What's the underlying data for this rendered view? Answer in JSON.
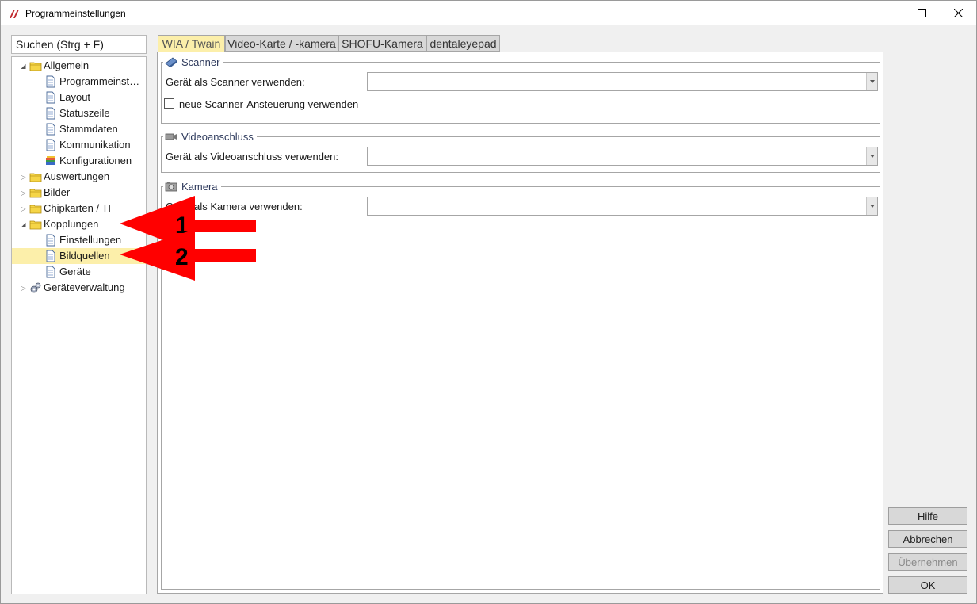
{
  "window": {
    "title": "Programmeinstellungen",
    "controls": {
      "minimize": "minimize-icon",
      "maximize": "maximize-icon",
      "close": "close-icon"
    }
  },
  "search": {
    "value": "Suchen (Strg + F)"
  },
  "tree": {
    "items": [
      {
        "label": "Allgemein",
        "icon": "folder-icon",
        "level": 0,
        "expanded": true
      },
      {
        "label": "Programmeinst…",
        "icon": "page-icon",
        "level": 1
      },
      {
        "label": "Layout",
        "icon": "page-icon",
        "level": 1
      },
      {
        "label": "Statuszeile",
        "icon": "page-icon",
        "level": 1
      },
      {
        "label": "Stammdaten",
        "icon": "page-icon",
        "level": 1
      },
      {
        "label": "Kommunikation",
        "icon": "page-icon",
        "level": 1
      },
      {
        "label": "Konfigurationen",
        "icon": "books-icon",
        "level": 1
      },
      {
        "label": "Auswertungen",
        "icon": "folder-icon",
        "level": 0,
        "expanded": false
      },
      {
        "label": "Bilder",
        "icon": "folder-icon",
        "level": 0,
        "expanded": false
      },
      {
        "label": "Chipkarten / TI",
        "icon": "folder-icon",
        "level": 0,
        "expanded": false
      },
      {
        "label": "Kopplungen",
        "icon": "folder-icon",
        "level": 0,
        "expanded": true
      },
      {
        "label": "Einstellungen",
        "icon": "page-icon",
        "level": 1
      },
      {
        "label": "Bildquellen",
        "icon": "page-icon",
        "level": 1,
        "selected": true
      },
      {
        "label": "Geräte",
        "icon": "page-icon",
        "level": 1
      },
      {
        "label": "Geräteverwaltung",
        "icon": "gears-icon",
        "level": 0,
        "expanded": false
      }
    ]
  },
  "tabs": [
    {
      "label": "WIA / Twain",
      "active": true
    },
    {
      "label": "Video-Karte / -kamera"
    },
    {
      "label": "SHOFU-Kamera"
    },
    {
      "label": "dentaleyepad"
    }
  ],
  "groups": {
    "scanner": {
      "title": "Scanner",
      "device_label": "Gerät als Scanner verwenden:",
      "device_value": "",
      "checkbox_label": "neue Scanner-Ansteuerung verwenden",
      "checkbox_checked": false
    },
    "video": {
      "title": "Videoanschluss",
      "device_label": "Gerät als Videoanschluss verwenden:",
      "device_value": ""
    },
    "camera": {
      "title": "Kamera",
      "device_label": "Gerät als Kamera verwenden:",
      "device_value": ""
    }
  },
  "buttons": {
    "help": "Hilfe",
    "cancel": "Abbrechen",
    "apply": "Übernehmen",
    "ok": "OK"
  },
  "annotations": {
    "arrow1": "1",
    "arrow2": "2",
    "color": "#ff0000"
  },
  "colors": {
    "selection": "#fcefaa",
    "active_tab": "#fcefaa",
    "button_face": "#d8d8d8"
  }
}
